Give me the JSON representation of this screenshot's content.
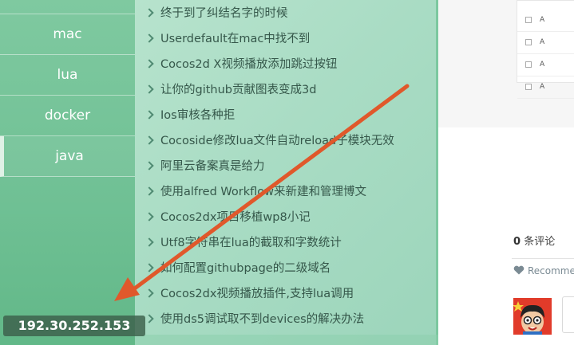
{
  "sidebar": {
    "items": [
      {
        "label": ""
      },
      {
        "label": "mac"
      },
      {
        "label": "lua"
      },
      {
        "label": "docker"
      },
      {
        "label": "java"
      }
    ],
    "active_index": 4
  },
  "article_list": {
    "items": [
      "终于到了纠结名字的时候",
      "Userdefault在mac中找不到",
      "Cocos2d X视频播放添加跳过按钮",
      "让你的github贡献图表变成3d",
      "Ios审核各种拒",
      "Cocoside修改lua文件自动reload子模块无效",
      "阿里云备案真是给力",
      "使用alfred Workflow来新建和管理博文",
      "Cocos2dx项目移植wp8小记",
      "Utf8字符串在lua的截取和字数统计",
      "如何配置githubpage的二级域名",
      "Cocos2dx视频播放插件,支持lua调用",
      "使用ds5调试取不到devices的解决办法"
    ]
  },
  "options": {
    "rows": [
      "A",
      "A",
      "A",
      "A"
    ]
  },
  "comments": {
    "count": "0",
    "count_suffix": "条评论",
    "recommend_label": "Recommend"
  },
  "overlay": {
    "ip_address": "192.30.252.153"
  },
  "colors": {
    "sidebar_green": "#6fc094",
    "list_mint": "#a9dcc4",
    "arrow_orange": "#e0582b",
    "avatar_red": "#e13b2a"
  }
}
